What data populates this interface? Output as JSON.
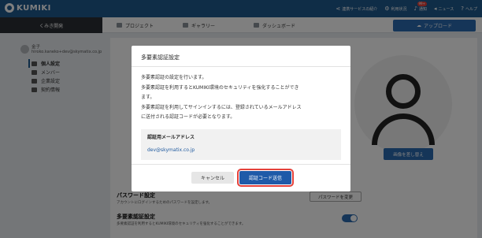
{
  "colors": {
    "header": "#1f5a8f",
    "accent": "#2a6ab0",
    "highlight": "#e5413a"
  },
  "header": {
    "logo_text": "KUMIKI",
    "links": [
      {
        "icon": "share-icon",
        "label": "連携サービスの紹介"
      },
      {
        "icon": "gear-icon",
        "label": "利用状況"
      },
      {
        "icon": "bell-icon",
        "label": "通知",
        "badge": "99+"
      },
      {
        "icon": "megaphone-icon",
        "label": "ニュース"
      },
      {
        "icon": "help-icon",
        "label": "ヘルプ"
      }
    ]
  },
  "nav": {
    "first": "くみき開発",
    "tabs": [
      "プロジェクト",
      "ギャラリー",
      "ダッシュボード"
    ],
    "upload_label": "アップロード"
  },
  "sidebar": {
    "user_name": "金子",
    "user_email": "hiroko.kaneko+dev@skymatix.co.jp",
    "items": [
      {
        "label": "個人設定",
        "icon": "user-settings-icon",
        "active": true
      },
      {
        "label": "メンバー",
        "icon": "members-icon",
        "active": false
      },
      {
        "label": "企業設定",
        "icon": "building-icon",
        "active": false
      },
      {
        "label": "契約情報",
        "icon": "document-icon",
        "active": false
      }
    ]
  },
  "background": {
    "change_image_label": "画像を差し替え",
    "password_title": "パスワード設定",
    "password_desc": "アカウントにログインするためのパスワードを設定します。",
    "password_button": "パスワードを変更",
    "mfa_title": "多要素認証設定",
    "mfa_desc": "多要素認証を利用するとKUMIKI環境のセキュリティを強化することができます。"
  },
  "modal": {
    "title": "多要素認証設定",
    "body_lines": [
      "多要素認証の設定を行います。",
      "多要素認証を利用するとKUMIKI環境のセキュリティを強化することができ",
      "ます。",
      "多要素認証を利用してサインインするには、登録されているメールアドレス",
      "に送付される認証コードが必要となります。"
    ],
    "email_label": "認証用メールアドレス",
    "email_value": "dev@skymatix.co.jp",
    "cancel_label": "キャンセル",
    "send_label": "認証コード送信"
  }
}
